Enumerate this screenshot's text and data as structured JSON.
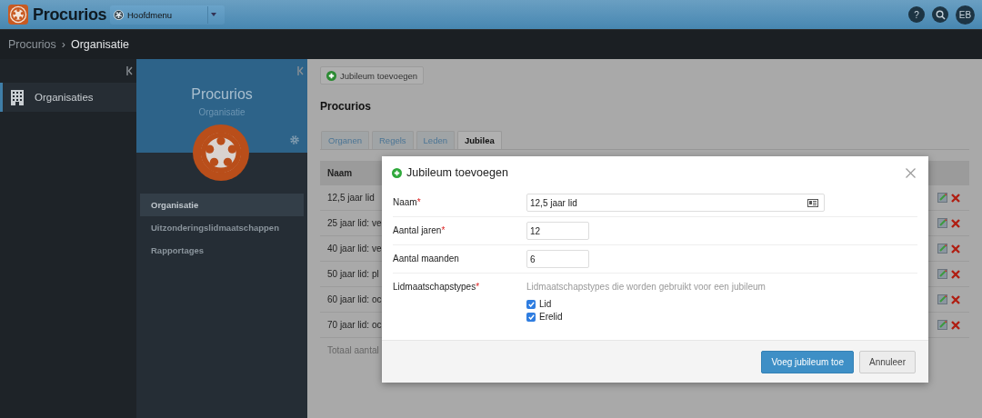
{
  "header": {
    "logo_text": "Procurios",
    "menu": "Hoofdmenu",
    "buttons": [
      {
        "kind": "help",
        "label": "?"
      },
      {
        "kind": "search"
      },
      {
        "kind": "user",
        "label": "EB"
      }
    ]
  },
  "breadcrumb": {
    "items": [
      "Procurios",
      "Organisatie"
    ],
    "separator": "›"
  },
  "sidebar": {
    "items": [
      {
        "label": "Organisaties",
        "selected": true
      }
    ]
  },
  "org_panel": {
    "title": "Procurios",
    "subtitle": "Organisatie",
    "menu": [
      {
        "label": "Organisatie",
        "selected": true
      },
      {
        "label": "Uitzonderingslidmaatschappen",
        "selected": false
      },
      {
        "label": "Rapportages",
        "selected": false
      }
    ]
  },
  "content": {
    "add_button": "Jubileum toevoegen",
    "title": "Procurios",
    "tabs": [
      {
        "label": "Organen",
        "selected": false
      },
      {
        "label": "Regels",
        "selected": false
      },
      {
        "label": "Leden",
        "selected": false
      },
      {
        "label": "Jubilea",
        "selected": true
      }
    ],
    "table": {
      "columns": [
        "Naam"
      ],
      "rows": [
        {
          "name": "12,5 jaar lid"
        },
        {
          "name": "25 jaar lid: ve"
        },
        {
          "name": "40 jaar lid: ve"
        },
        {
          "name": "50 jaar lid: pl"
        },
        {
          "name": "60 jaar lid: oc"
        },
        {
          "name": "70 jaar lid: oc"
        }
      ],
      "footer": "Totaal aantal"
    }
  },
  "modal": {
    "title": "Jubileum toevoegen",
    "fields": [
      {
        "kind": "text",
        "label": "Naam",
        "required_mark": "*",
        "value": "12,5 jaar lid"
      },
      {
        "kind": "number",
        "label": "Aantal jaren",
        "required_mark": "*",
        "value": "12"
      },
      {
        "kind": "number",
        "label": "Aantal maanden",
        "value": "6"
      },
      {
        "kind": "checkboxes",
        "label": "Lidmaatschapstypes",
        "required_mark": "*",
        "hint": "Lidmaatschapstypes die worden gebruikt voor een jubileum",
        "options": [
          {
            "label": "Lid",
            "checked": true
          },
          {
            "label": "Erelid",
            "checked": true
          }
        ]
      }
    ],
    "buttons": [
      {
        "label": "Voeg jubileum toe",
        "primary": true
      },
      {
        "label": "Annuleer",
        "primary": false
      }
    ]
  }
}
